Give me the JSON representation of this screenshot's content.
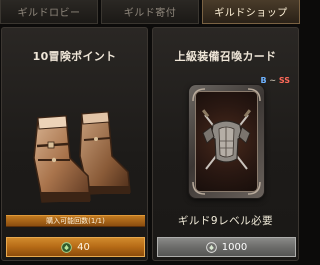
{
  "tabs": [
    {
      "label": "ギルドロビー",
      "active": false
    },
    {
      "label": "ギルド寄付",
      "active": false
    },
    {
      "label": "ギルドショップ",
      "active": true
    }
  ],
  "items": [
    {
      "title": "10冒険ポイント",
      "image": "boots-icon",
      "purchase_limit": "購入可能回数(1/1)",
      "price": "40",
      "currency_icon": "guild-coin-green-icon",
      "button_color": "#c47a1f"
    },
    {
      "title": "上級装備召喚カード",
      "image": "armor-summon-card-icon",
      "rarity": {
        "low": "B",
        "separator": " ~ ",
        "high": "SS"
      },
      "requirement": "ギルド9レベル必要",
      "price": "1000",
      "currency_icon": "guild-coin-silver-icon",
      "button_color": "#6c6c6a"
    }
  ],
  "colors": {
    "rarity_b": "#6fb3ff",
    "rarity_ss": "#ff6a5a",
    "active_tab": "#4a3c2a"
  }
}
